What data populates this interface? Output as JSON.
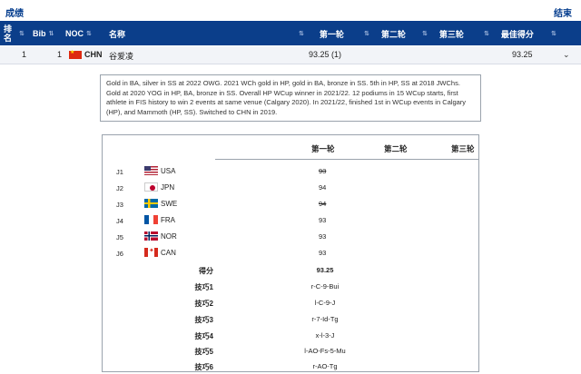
{
  "page": {
    "title": "成绩",
    "status": "结束"
  },
  "header": {
    "rank": [
      "排",
      "名"
    ],
    "bib": "Bib",
    "noc": "NOC",
    "name": "名称",
    "run1": "第一轮",
    "run2": "第二轮",
    "run3": "第三轮",
    "best": "最佳得分"
  },
  "athlete": {
    "rank": "1",
    "bib": "1",
    "noc": "CHN",
    "name": "谷爱凌",
    "run1": "93.25 (1)",
    "best": "93.25"
  },
  "bio": "Gold in BA, silver in SS at 2022 OWG. 2021 WCh gold in HP, gold in BA, bronze in SS. 5th in HP, SS at 2018 JWChs. Gold at 2020 YOG in HP, BA, bronze in SS. Overall HP WCup winner in 2021/22. 12 podiums in 15 WCup starts, first athlete in FIS history to win 2 events at same venue (Calgary 2020). In 2021/22, finished 1st in WCup events in Calgary (HP), and Mammoth (HP, SS). Switched to CHN in 2019.",
  "detail": {
    "cols": [
      "第一轮",
      "第二轮",
      "第三轮"
    ],
    "judges": [
      {
        "id": "J1",
        "noc": "USA",
        "flag": "usa",
        "score": "93",
        "struck": true
      },
      {
        "id": "J2",
        "noc": "JPN",
        "flag": "jpn",
        "score": "94",
        "struck": false
      },
      {
        "id": "J3",
        "noc": "SWE",
        "flag": "swe",
        "score": "94",
        "struck": true
      },
      {
        "id": "J4",
        "noc": "FRA",
        "flag": "fra",
        "score": "93",
        "struck": false
      },
      {
        "id": "J5",
        "noc": "NOR",
        "flag": "nor",
        "score": "93",
        "struck": false
      },
      {
        "id": "J6",
        "noc": "CAN",
        "flag": "can",
        "score": "93",
        "struck": false
      }
    ],
    "score_label": "得分",
    "score_value": "93.25",
    "tricks": [
      {
        "label": "技巧1",
        "value": "r-C-9-Bui"
      },
      {
        "label": "技巧2",
        "value": "l-C-9-J"
      },
      {
        "label": "技巧3",
        "value": "r-7-Id-Tg"
      },
      {
        "label": "技巧4",
        "value": "x-l-3-J"
      },
      {
        "label": "技巧5",
        "value": "l-AO-Fs-5-Mu"
      },
      {
        "label": "技巧6",
        "value": "r-AO-Tg"
      }
    ]
  }
}
